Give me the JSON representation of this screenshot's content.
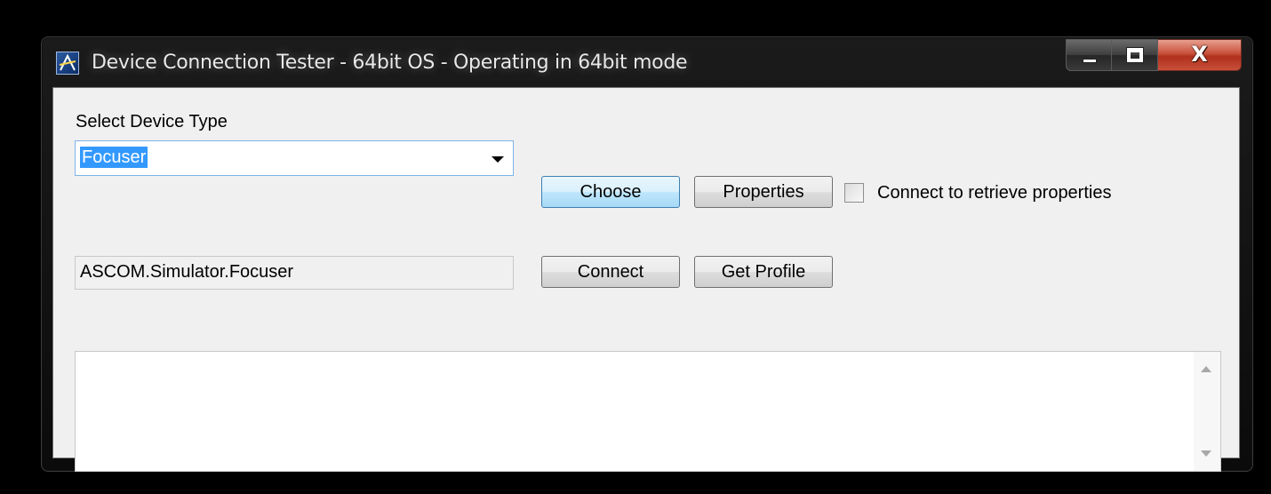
{
  "window": {
    "title": "Device Connection Tester - 64bit OS - Operating in 64bit mode",
    "app_icon": "ascom-telescope-icon",
    "caption_buttons": {
      "minimize_icon": "minimize-icon",
      "maximize_icon": "maximize-icon",
      "close_glyph": "X"
    }
  },
  "device_type": {
    "label": "Select Device Type",
    "selected": "Focuser"
  },
  "buttons": {
    "choose": "Choose",
    "properties": "Properties",
    "connect": "Connect",
    "get_profile": "Get Profile"
  },
  "options": {
    "connect_to_retrieve": {
      "label": "Connect to retrieve properties",
      "checked": false
    }
  },
  "driver_id": {
    "value": "ASCOM.Simulator.Focuser"
  },
  "log": {
    "text": ""
  },
  "colors": {
    "selection": "#3399ff",
    "close_button": "#c8503a",
    "focus_border": "#3c7fb1"
  }
}
